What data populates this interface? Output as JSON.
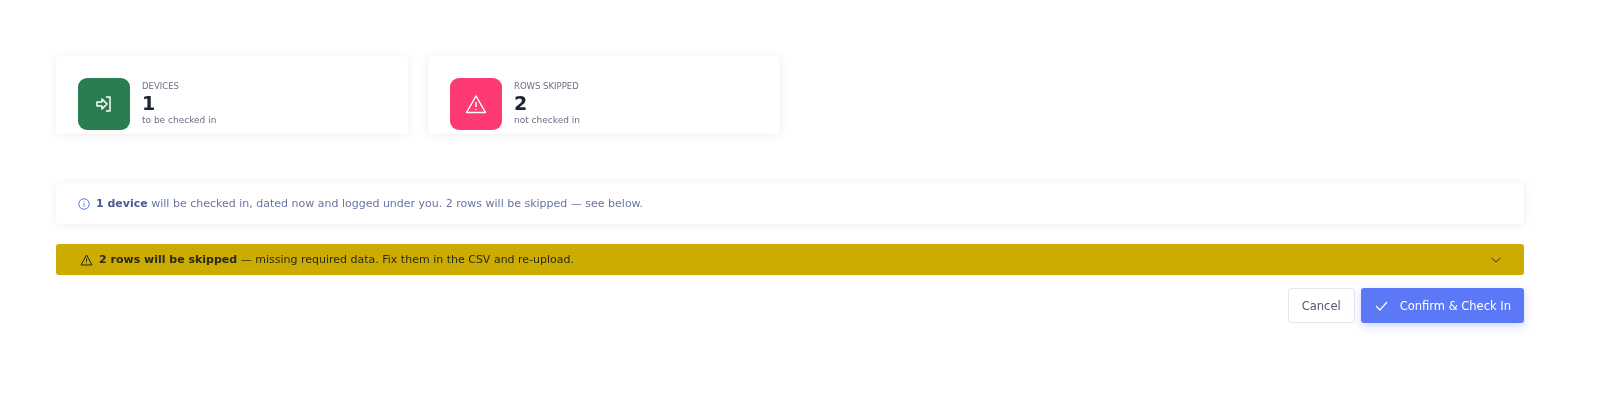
{
  "stats": [
    {
      "kind": "enter",
      "color": "#2a7d4f",
      "label": "DEVICES",
      "value": "1",
      "caption": "to be checked in"
    },
    {
      "kind": "warning",
      "color": "#fd3a74",
      "label": "ROWS SKIPPED",
      "value": "2",
      "caption": "not checked in"
    }
  ],
  "info": {
    "text": "**1 device** will be checked in, dated now and logged under you. 2 rows will be skipped — see below."
  },
  "warning": {
    "text": "**2 rows will be skipped** — missing required data. Fix them in the CSV and re-upload.",
    "expanded": false
  },
  "buttons": [
    {
      "kind": "secondary",
      "label": "Cancel"
    },
    {
      "kind": "primary",
      "label": "Confirm & Check In"
    }
  ]
}
